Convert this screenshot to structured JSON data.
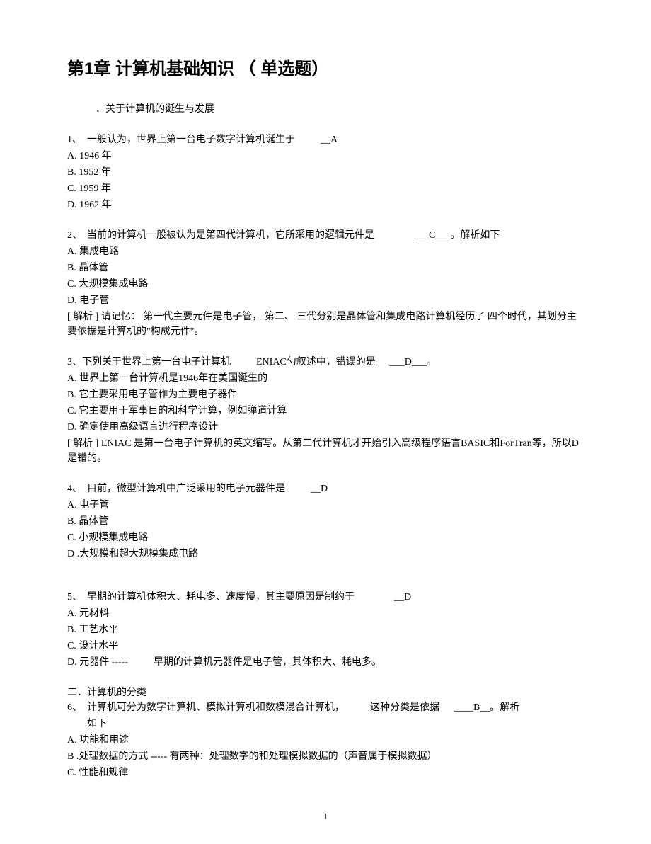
{
  "title": "第1章 计算机基础知识 （ 单选题）",
  "section1": "．关于计算机的诞生与发展",
  "q1": {
    "text_prefix": "1、　一般认为，世界上第一台电子数字计算机诞生于",
    "answer": "__A",
    "a": "A.  1946 年",
    "b": "B.  1952 年",
    "c": "C.  1959 年",
    "d": "D.  1962 年"
  },
  "q2": {
    "text_prefix": "2、　当前的计算机一般被认为是第四代计算机，它所采用的逻辑元件是",
    "answer": "___C___",
    "suffix": "。解析如下",
    "a": "A.  集成电路",
    "b": "B.  晶体管",
    "c": "C.  大规模集成电路",
    "d": "D.  电子管",
    "analysis": "[ 解析 ] 请记忆：  第一代主要元件是电子管，  第二、  三代分别是晶体管和集成电路计算机经历了  四个时代，其划分主要依据是计算机的\"构成元件\"。"
  },
  "q3": {
    "text_prefix": "3、下列关于世界上第一台电子计算机",
    "mid": "ENIAC勺叙述中，错误的是",
    "answer": "___D___",
    "suffix": "。",
    "a": "A.  世界上第一台计算机是1946年在美国诞生的",
    "b": "B.  它主要采用电子管作为主要电子器件",
    "c": "C.  它主要用于军事目的和科学计算，例如弹道计算",
    "d": "D.  确定使用高级语言进行程序设计",
    "analysis": "[ 解析 ] ENIAC 是第一台电子计算机的英文缩写。从第二代计算机才开始引入高级程序语言BASIC和ForTran等，所以D是错的。"
  },
  "q4": {
    "text_prefix": "4、　目前，微型计算机中广泛采用的电子元器件是",
    "answer": "__D",
    "a": "A.  电子管",
    "b": "B.  晶体管",
    "c": "C.  小规模集成电路",
    "d": "D .大规模和超大规模集成电路"
  },
  "q5": {
    "text_prefix": "5、　早期的计算机体积大、耗电多、速度慢，其主要原因是制约于",
    "answer": "__D",
    "a": "A.  元材料",
    "b": "B.  工艺水平",
    "c": "C.  设计水平",
    "d_prefix": "D.  元器件 -----",
    "d_suffix": "早期的计算机元器件是电子管，其体积大、耗电多。"
  },
  "section2": "二．计算机的分类",
  "q6": {
    "text_prefix": "6、　计算机可分为数字计算机、模拟计算机和数模混合计算机，",
    "mid": "这种分类是依据",
    "answer": "____B__",
    "suffix": "。解析",
    "indent_text": "如下",
    "a": "A.  功能和用途",
    "b": "B .处理数据的方式  -----  有两种：处理数字的和处理模拟数据的（声音属于模拟数据）",
    "c": "C.  性能和规律"
  },
  "page_num": "1"
}
